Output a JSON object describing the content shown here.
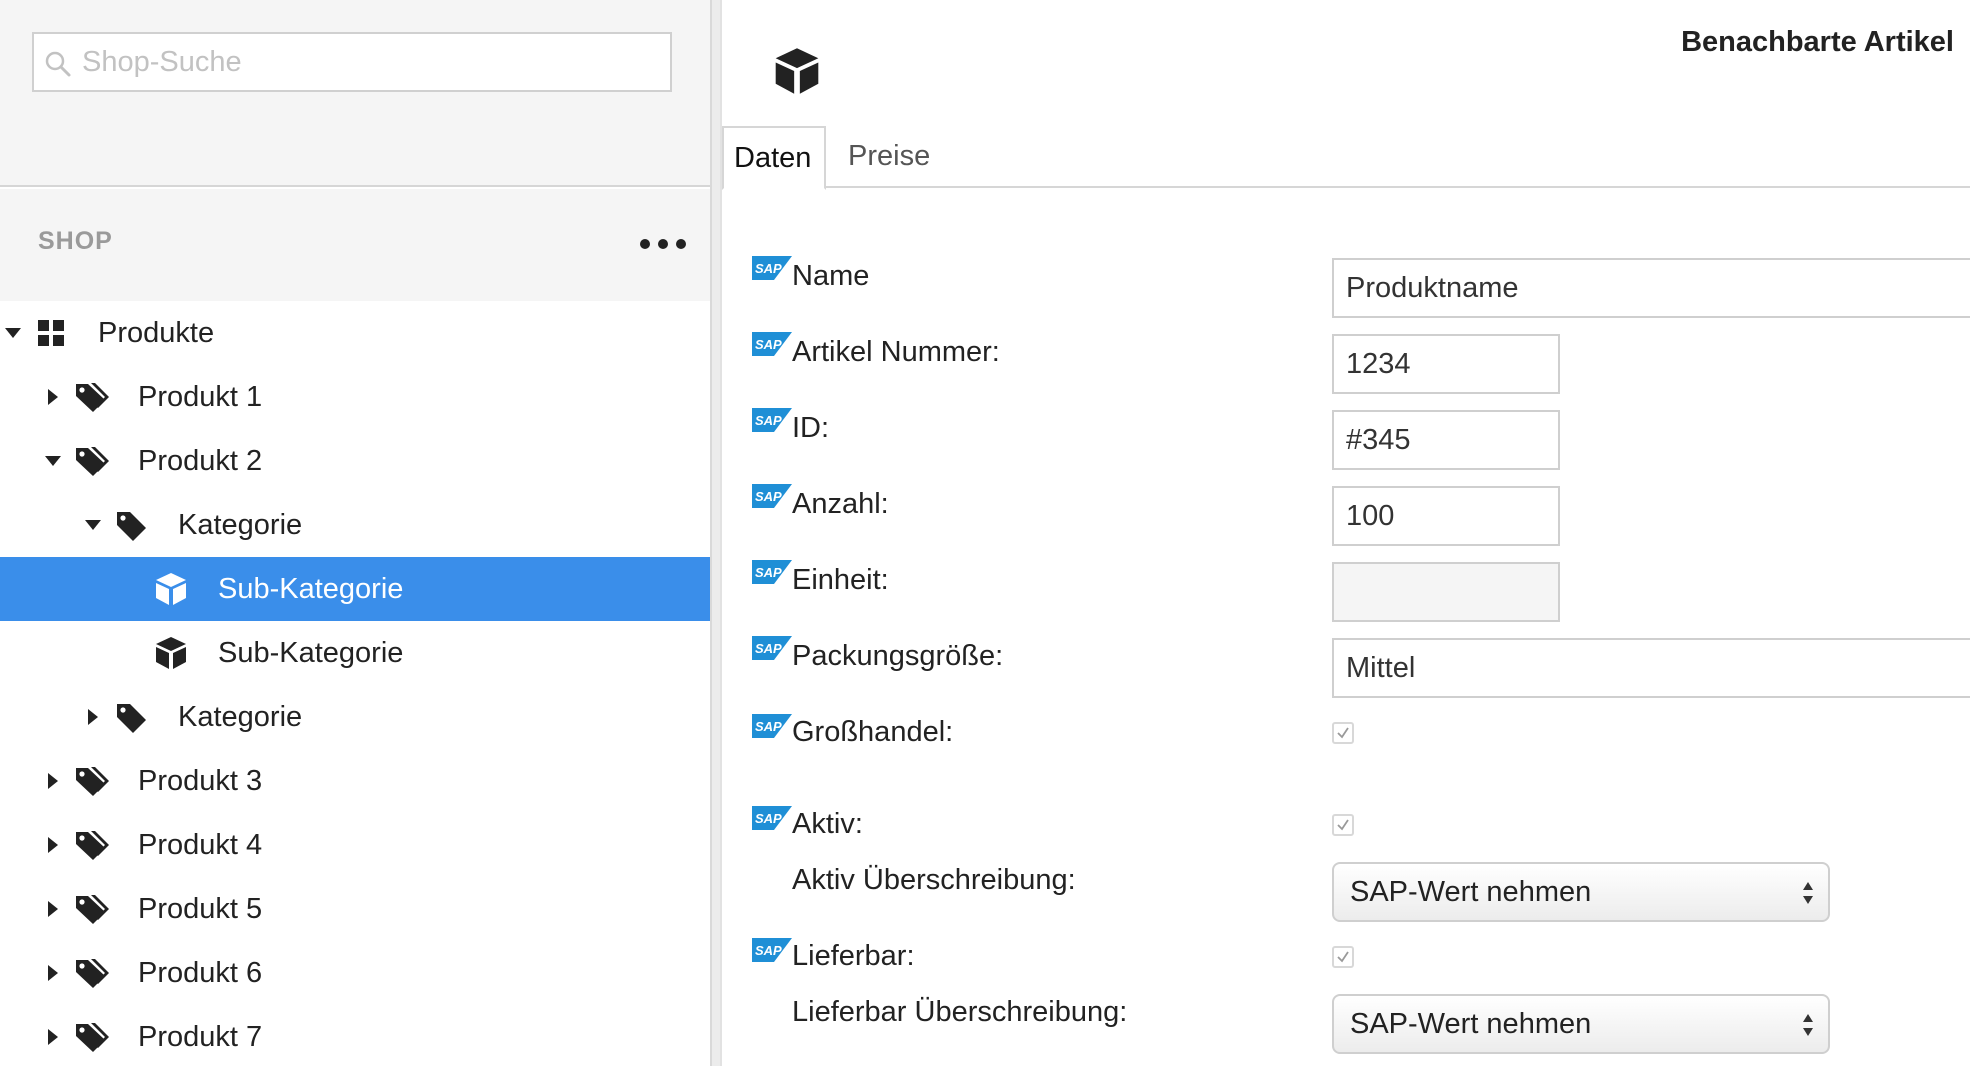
{
  "search": {
    "placeholder": "Shop-Suche"
  },
  "shop": {
    "title": "SHOP"
  },
  "tree": [
    {
      "label": "Produkte",
      "level": 0,
      "expanded": true,
      "icon": "grid-icon",
      "selected": false
    },
    {
      "label": "Produkt 1",
      "level": 1,
      "expanded": false,
      "icon": "tags-icon",
      "selected": false
    },
    {
      "label": "Produkt 2",
      "level": 1,
      "expanded": true,
      "icon": "tags-icon",
      "selected": false
    },
    {
      "label": "Kategorie",
      "level": 2,
      "expanded": true,
      "icon": "tag-icon",
      "selected": false
    },
    {
      "label": "Sub-Kategorie",
      "level": 3,
      "expanded": null,
      "icon": "cube-icon",
      "selected": true
    },
    {
      "label": "Sub-Kategorie",
      "level": 3,
      "expanded": null,
      "icon": "cube-icon",
      "selected": false
    },
    {
      "label": "Kategorie",
      "level": 2,
      "expanded": false,
      "icon": "tag-icon",
      "selected": false
    },
    {
      "label": "Produkt 3",
      "level": 1,
      "expanded": false,
      "icon": "tags-icon",
      "selected": false
    },
    {
      "label": "Produkt 4",
      "level": 1,
      "expanded": false,
      "icon": "tags-icon",
      "selected": false
    },
    {
      "label": "Produkt 5",
      "level": 1,
      "expanded": false,
      "icon": "tags-icon",
      "selected": false
    },
    {
      "label": "Produkt 6",
      "level": 1,
      "expanded": false,
      "icon": "tags-icon",
      "selected": false
    },
    {
      "label": "Produkt 7",
      "level": 1,
      "expanded": false,
      "icon": "tags-icon",
      "selected": false
    }
  ],
  "main": {
    "neighbors_label": "Benachbarte Artikel",
    "tabs": [
      {
        "label": "Daten",
        "active": true
      },
      {
        "label": "Preise",
        "active": false
      }
    ],
    "sap_badge": "SAP",
    "fields": {
      "name": {
        "label": "Name",
        "value": "Produktname"
      },
      "article_number": {
        "label": "Artikel Nummer:",
        "value": "1234"
      },
      "id": {
        "label": "ID:",
        "value": "#345"
      },
      "count": {
        "label": "Anzahl:",
        "value": "100"
      },
      "unit": {
        "label": "Einheit:",
        "value": ""
      },
      "package_size": {
        "label": "Packungsgröße:",
        "value": "Mittel"
      },
      "wholesale": {
        "label": "Großhandel:",
        "checked": true
      },
      "active": {
        "label": "Aktiv:",
        "checked": true
      },
      "active_override": {
        "label": "Aktiv Überschreibung:",
        "value": "SAP-Wert nehmen"
      },
      "deliverable": {
        "label": "Lieferbar:",
        "checked": true
      },
      "deliverable_override": {
        "label": "Lieferbar Überschreibung:",
        "value": "SAP-Wert nehmen"
      }
    }
  },
  "colors": {
    "selection": "#3a8eea",
    "sap_blue": "#1f8fd6",
    "sidebar_bg": "#f5f5f5"
  }
}
